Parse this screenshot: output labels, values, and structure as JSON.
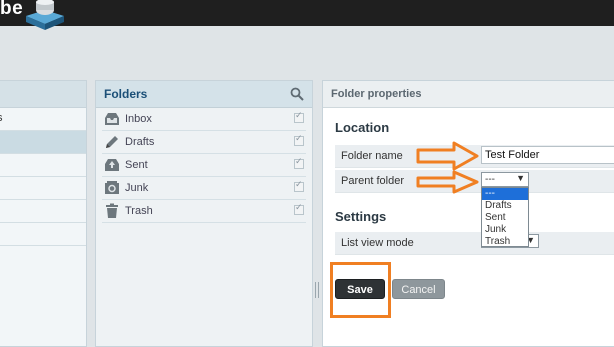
{
  "app": {
    "brand_fragment": "be"
  },
  "folders_panel": {
    "title": "Folders",
    "items": [
      {
        "label": "Inbox",
        "icon": "inbox-icon"
      },
      {
        "label": "Drafts",
        "icon": "pencil-icon"
      },
      {
        "label": "Sent",
        "icon": "sent-icon"
      },
      {
        "label": "Junk",
        "icon": "junk-icon"
      },
      {
        "label": "Trash",
        "icon": "trash-icon"
      }
    ]
  },
  "left_panel": {
    "row1": "s"
  },
  "properties_panel": {
    "title": "Folder properties",
    "location_title": "Location",
    "folder_name_label": "Folder name",
    "folder_name_value": "Test Folder",
    "parent_folder_label": "Parent folder",
    "parent_folder_value": "---",
    "parent_folder_options": [
      "---",
      "Drafts",
      "Sent",
      "Junk",
      "Trash"
    ],
    "settings_title": "Settings",
    "list_view_mode_label": "List view mode",
    "save_label": "Save",
    "cancel_label": "Cancel"
  },
  "colors": {
    "annotation": "#f07f22",
    "header_bg": "#1f1f1f",
    "accent": "#1b4f77"
  }
}
